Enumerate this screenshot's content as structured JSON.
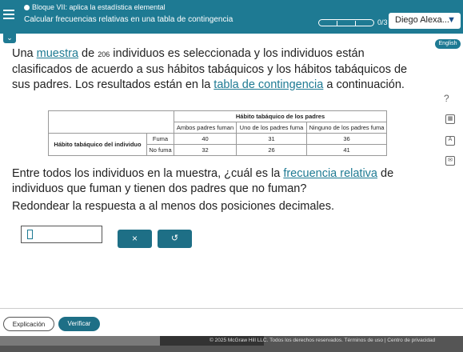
{
  "header": {
    "section": "Bloque VII: aplica la estadística elemental",
    "topic": "Calcular frecuencias relativas en una tabla de contingencia",
    "score": "0/3",
    "user": "Diego Alexa..."
  },
  "language": "English",
  "question": {
    "intro_1": "Una ",
    "muestra": "muestra",
    "intro_2": " de ",
    "n": "206",
    "intro_3": " individuos es seleccionada y los individuos están clasificados de acuerdo a sus hábitos tabáquicos y los hábitos tabáquicos de sus padres. Los resultados están en la ",
    "tabla": "tabla de contingencia",
    "intro_4": " a continuación."
  },
  "table": {
    "col_group": "Hábito tabáquico de los padres",
    "row_group": "Hábito tabáquico del individuo",
    "columns": [
      "Ambos padres fuman",
      "Uno de los padres fuma",
      "Ninguno de los padres fuma"
    ],
    "rows": [
      {
        "label": "Fuma",
        "values": [
          "40",
          "31",
          "36"
        ]
      },
      {
        "label": "No fuma",
        "values": [
          "32",
          "26",
          "41"
        ]
      }
    ]
  },
  "prompt": {
    "p1": "Entre todos los individuos en la muestra, ¿cuál es la ",
    "frecuencia": "frecuencia relativa",
    "p2": " de individuos que fuman y tienen dos padres que no fuman?",
    "round": "Redondear la respuesta a al menos dos posiciones decimales."
  },
  "answer_value": "",
  "buttons": {
    "clear": "×",
    "undo": "↺",
    "explicacion": "Explicación",
    "verificar": "Verificar"
  },
  "side_icons": [
    "help-icon",
    "calculator-icon",
    "text-icon",
    "mail-icon"
  ],
  "help_symbol": "?",
  "footer": "© 2025 McGraw Hill LLC. Todos los derechos reservados.   Términos de uso   |   Centro de privacidad"
}
